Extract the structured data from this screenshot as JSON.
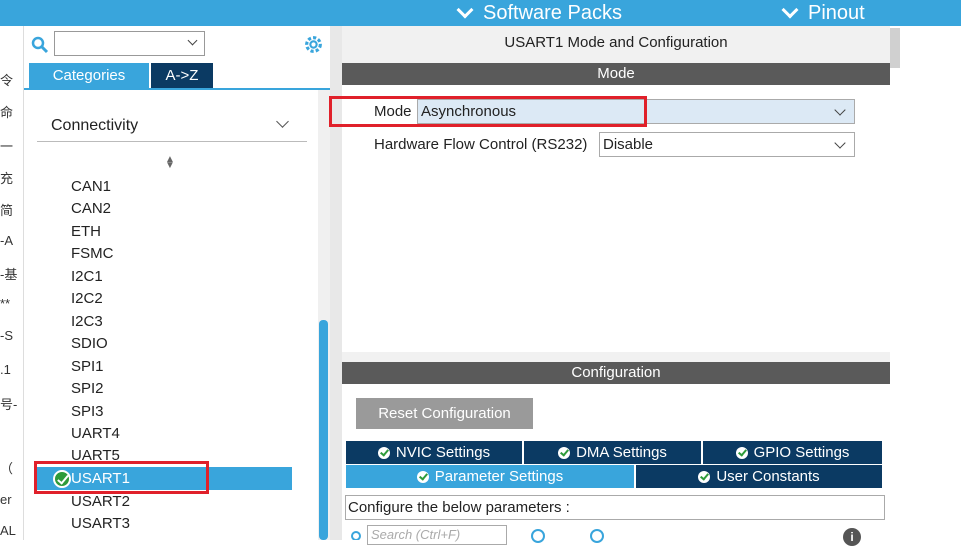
{
  "topbar": {
    "software_packs": "Software Packs",
    "pinout": "Pinout"
  },
  "left_edge_chars": [
    "令",
    "命",
    "一",
    "充",
    "简",
    "-A",
    "-基",
    "**",
    "-S",
    ".1",
    "号-",
    "（",
    "er",
    "AL"
  ],
  "left": {
    "search": {
      "value": ""
    },
    "tabs": {
      "categories": "Categories",
      "az": "A->Z"
    },
    "section": "Connectivity",
    "peripherals": [
      "CAN1",
      "CAN2",
      "ETH",
      "FSMC",
      "I2C1",
      "I2C2",
      "I2C3",
      "SDIO",
      "SPI1",
      "SPI2",
      "SPI3",
      "UART4",
      "UART5",
      "USART1",
      "USART2",
      "USART3"
    ],
    "selected": "USART1"
  },
  "main": {
    "title": "USART1 Mode and Configuration",
    "mode_header": "Mode",
    "mode_label": "Mode",
    "mode_value": "Asynchronous",
    "hwflow_label": "Hardware Flow Control (RS232)",
    "hwflow_value": "Disable",
    "config_header": "Configuration",
    "reset_button": "Reset Configuration",
    "config_tabs": [
      "NVIC Settings",
      "DMA Settings",
      "GPIO Settings",
      "Parameter Settings",
      "User Constants"
    ],
    "active_tab": "Parameter Settings",
    "param_text": "Configure the below parameters :",
    "param_search_placeholder": "Search (Ctrl+F)"
  },
  "colors": {
    "accent": "#39a5dc",
    "dark_tab": "#0b3a63",
    "highlight_box": "#e0202a"
  }
}
